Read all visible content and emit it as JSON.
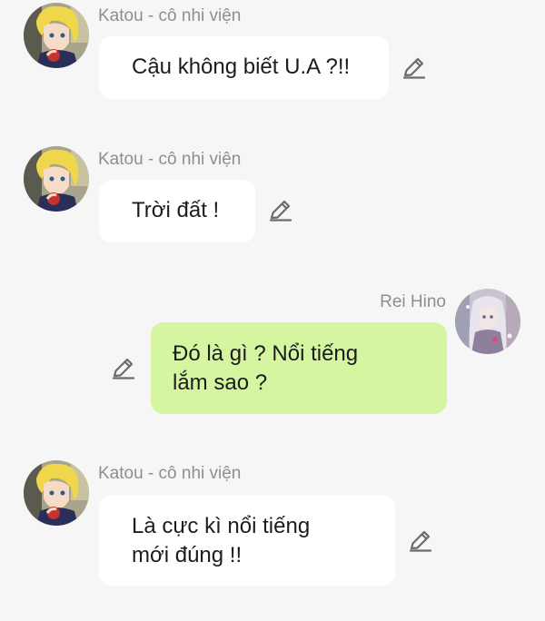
{
  "messages": [
    {
      "sender": "Katou - cô nhi viện",
      "text": "Cậu không biết U.A ?!!",
      "avatar_icon": "katou-avatar",
      "side": "left"
    },
    {
      "sender": "Katou - cô nhi viện",
      "text": "Trời đất !",
      "avatar_icon": "katou-avatar",
      "side": "left"
    },
    {
      "sender": "Rei Hino",
      "text": "Đó là gì ? Nổi tiếng\nlắm sao ?",
      "avatar_icon": "rei-avatar",
      "side": "right"
    },
    {
      "sender": "Katou - cô nhi viện",
      "text": "Là cực kì nổi tiếng\nmới đúng !!",
      "avatar_icon": "katou-avatar",
      "side": "left"
    }
  ],
  "edit_icon": "pencil-edit-icon",
  "colors": {
    "background": "#f6f6f6",
    "bubble_left": "#ffffff",
    "bubble_right": "#d6f5a0",
    "sender_name": "#8e8e8e",
    "message_text": "#1c1c1c",
    "edit_icon": "#6b6b6b"
  }
}
